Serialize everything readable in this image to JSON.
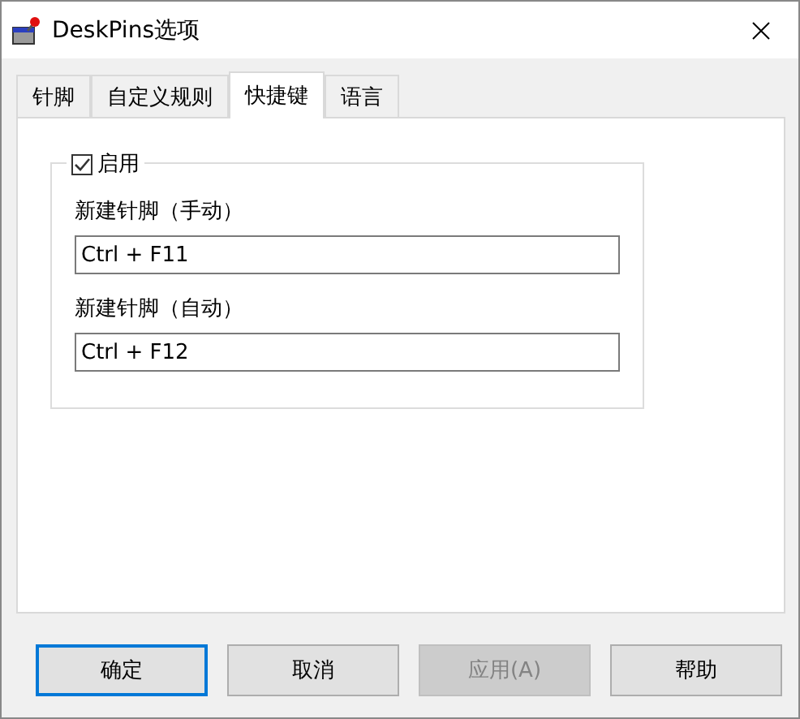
{
  "window": {
    "title": "DeskPins选项"
  },
  "tabs": [
    {
      "label": "针脚",
      "selected": false
    },
    {
      "label": "自定义规则",
      "selected": false
    },
    {
      "label": "快捷键",
      "selected": true
    },
    {
      "label": "语言",
      "selected": false
    }
  ],
  "hotkeys": {
    "enabled": {
      "label": "启用",
      "checked": true
    },
    "fields": [
      {
        "label": "新建针脚（手动）",
        "value": "Ctrl + F11"
      },
      {
        "label": "新建针脚（自动）",
        "value": "Ctrl + F12"
      }
    ]
  },
  "buttons": [
    {
      "label": "确定",
      "default": true,
      "disabled": false
    },
    {
      "label": "取消",
      "default": false,
      "disabled": false
    },
    {
      "label": "应用(A)",
      "default": false,
      "disabled": true
    },
    {
      "label": "帮助",
      "default": false,
      "disabled": false
    }
  ]
}
